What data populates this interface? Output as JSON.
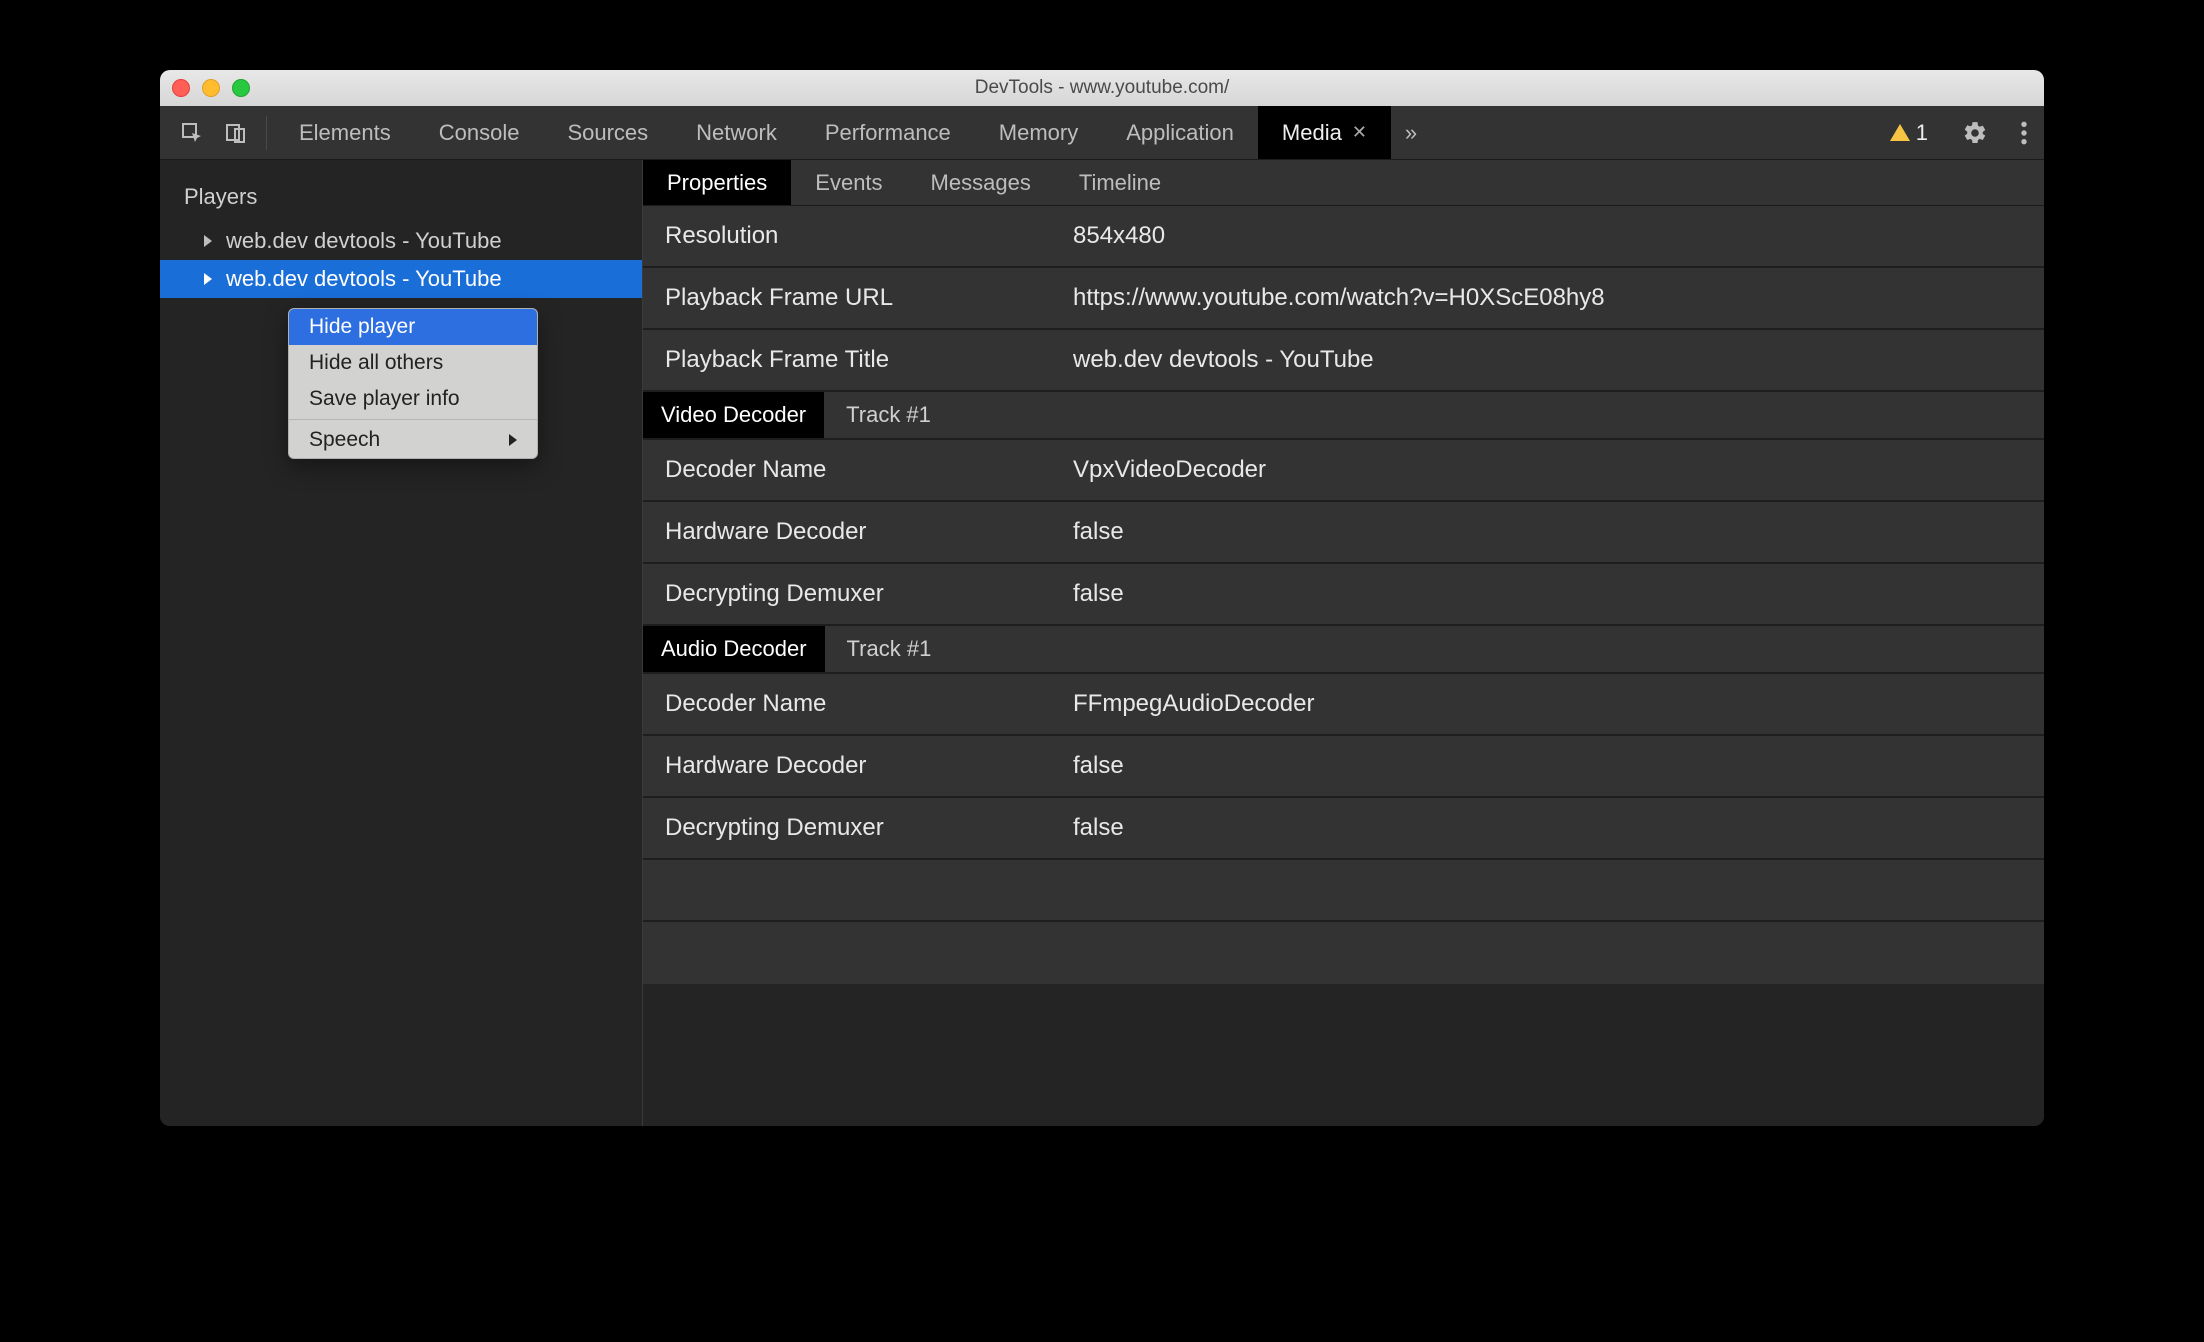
{
  "window": {
    "title": "DevTools - www.youtube.com/"
  },
  "toolbar": {
    "tabs": [
      "Elements",
      "Console",
      "Sources",
      "Network",
      "Performance",
      "Memory",
      "Application",
      "Media"
    ],
    "active_tab": "Media",
    "warning_count": "1"
  },
  "sidebar": {
    "title": "Players",
    "players": [
      {
        "label": "web.dev devtools - YouTube",
        "selected": false
      },
      {
        "label": "web.dev devtools - YouTube",
        "selected": true
      }
    ]
  },
  "context_menu": {
    "items": [
      {
        "label": "Hide player",
        "highlight": true
      },
      {
        "label": "Hide all others"
      },
      {
        "label": "Save player info"
      }
    ],
    "speech_label": "Speech"
  },
  "subtabs": {
    "items": [
      "Properties",
      "Events",
      "Messages",
      "Timeline"
    ],
    "active": "Properties"
  },
  "properties": {
    "rows": [
      {
        "label": "Resolution",
        "value": "854x480"
      },
      {
        "label": "Playback Frame URL",
        "value": "https://www.youtube.com/watch?v=H0XScE08hy8"
      },
      {
        "label": "Playback Frame Title",
        "value": "web.dev devtools - YouTube"
      }
    ],
    "video_decoder": {
      "header": "Video Decoder",
      "track": "Track #1",
      "rows": [
        {
          "label": "Decoder Name",
          "value": "VpxVideoDecoder"
        },
        {
          "label": "Hardware Decoder",
          "value": "false"
        },
        {
          "label": "Decrypting Demuxer",
          "value": "false"
        }
      ]
    },
    "audio_decoder": {
      "header": "Audio Decoder",
      "track": "Track #1",
      "rows": [
        {
          "label": "Decoder Name",
          "value": "FFmpegAudioDecoder"
        },
        {
          "label": "Hardware Decoder",
          "value": "false"
        },
        {
          "label": "Decrypting Demuxer",
          "value": "false"
        }
      ]
    }
  }
}
